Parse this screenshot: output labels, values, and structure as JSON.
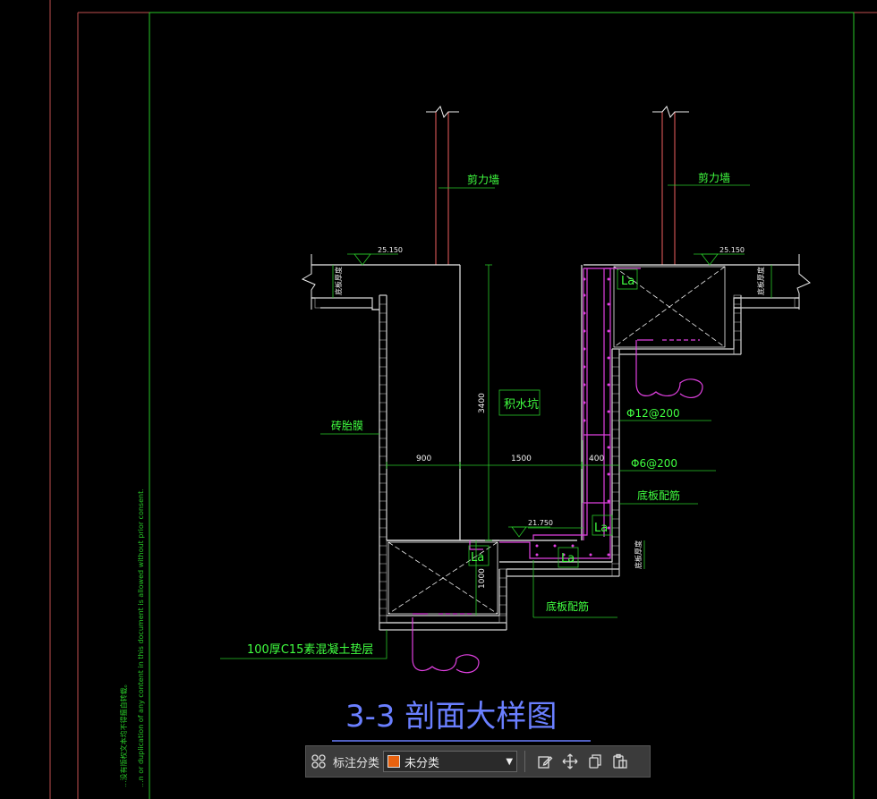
{
  "drawing": {
    "title": "3-3 剖面大样图",
    "labels": {
      "shear_wall_left": "剪力墙",
      "shear_wall_right": "剪力墙",
      "sump": "积水坑",
      "brick_mold": "砖胎膜",
      "cushion": "100厚C15素混凝土垫层",
      "bar_main": "Φ12@200",
      "bar_dist": "Φ6@200",
      "bottom_bar_right": "底板配筋",
      "bottom_bar_bottom": "底板配筋",
      "slab_thk_left": "底板厚度",
      "slab_thk_right": "底板厚度",
      "slab_thk_lower": "底板厚度",
      "la1": "La",
      "la2": "La",
      "la3": "La",
      "la4": "La"
    },
    "elevations": {
      "left": "25.150",
      "right": "25.150",
      "pit": "21.750"
    },
    "dimensions": {
      "d900": "900",
      "d1500": "1500",
      "d400": "400",
      "d3400": "3400",
      "d1000": "1000"
    },
    "side_note_1": "...n or duplication of any content in this document is allowed without prior consent.",
    "side_note_2": "...没有版权文本均不得擅自转载。"
  },
  "toolbar": {
    "label": "标注分类",
    "selected": "未分类",
    "swatch_color": "#e8620f",
    "icons": [
      "grid-icon",
      "edit-icon",
      "move-icon",
      "copy-icon",
      "paste-icon"
    ]
  },
  "colors": {
    "frame_red": "#c05050",
    "frame_green": "#28c828",
    "wall": "#f0f0f0",
    "rebar": "#e040e0",
    "text_green": "#40ff40",
    "title_blue": "#6a7fff"
  }
}
